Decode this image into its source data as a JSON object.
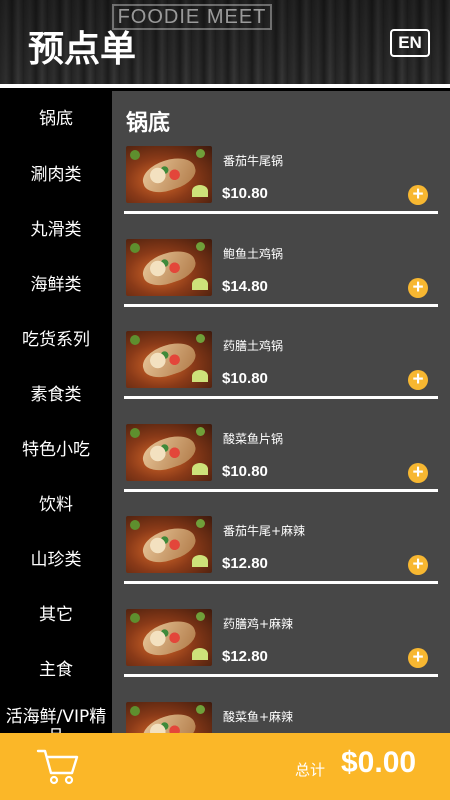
{
  "header": {
    "title": "预点单",
    "lang_button": "EN",
    "sign_text": "FOODIE MEET"
  },
  "sidebar": {
    "items": [
      {
        "label": "锅底"
      },
      {
        "label": "涮肉类"
      },
      {
        "label": "丸滑类"
      },
      {
        "label": "海鲜类"
      },
      {
        "label": "吃货系列"
      },
      {
        "label": "素食类"
      },
      {
        "label": "特色小吃"
      },
      {
        "label": "饮料"
      },
      {
        "label": "山珍类"
      },
      {
        "label": "其它"
      },
      {
        "label": "主食"
      },
      {
        "label": "活海鲜/VIP精品"
      }
    ]
  },
  "main": {
    "section_title": "锅底",
    "items": [
      {
        "name": "番茄牛尾锅",
        "price": "$10.80",
        "add": "+"
      },
      {
        "name": "鲍鱼土鸡锅",
        "price": "$14.80",
        "add": "+"
      },
      {
        "name": "药膳土鸡锅",
        "price": "$10.80",
        "add": "+"
      },
      {
        "name": "酸菜鱼片锅",
        "price": "$10.80",
        "add": "+"
      },
      {
        "name": "番茄牛尾+麻辣",
        "price": "$12.80",
        "add": "+"
      },
      {
        "name": "药膳鸡+麻辣",
        "price": "$12.80",
        "add": "+"
      },
      {
        "name": "酸菜鱼+麻辣",
        "price": "",
        "add": ""
      }
    ]
  },
  "footer": {
    "total_label": "总计",
    "total_value": "$0.00"
  },
  "colors": {
    "accent": "#fbb728",
    "content_bg": "#474747",
    "sidebar_bg": "#000000"
  },
  "icons": {
    "cart": "shopping-cart-icon",
    "add": "plus-circle-icon"
  }
}
